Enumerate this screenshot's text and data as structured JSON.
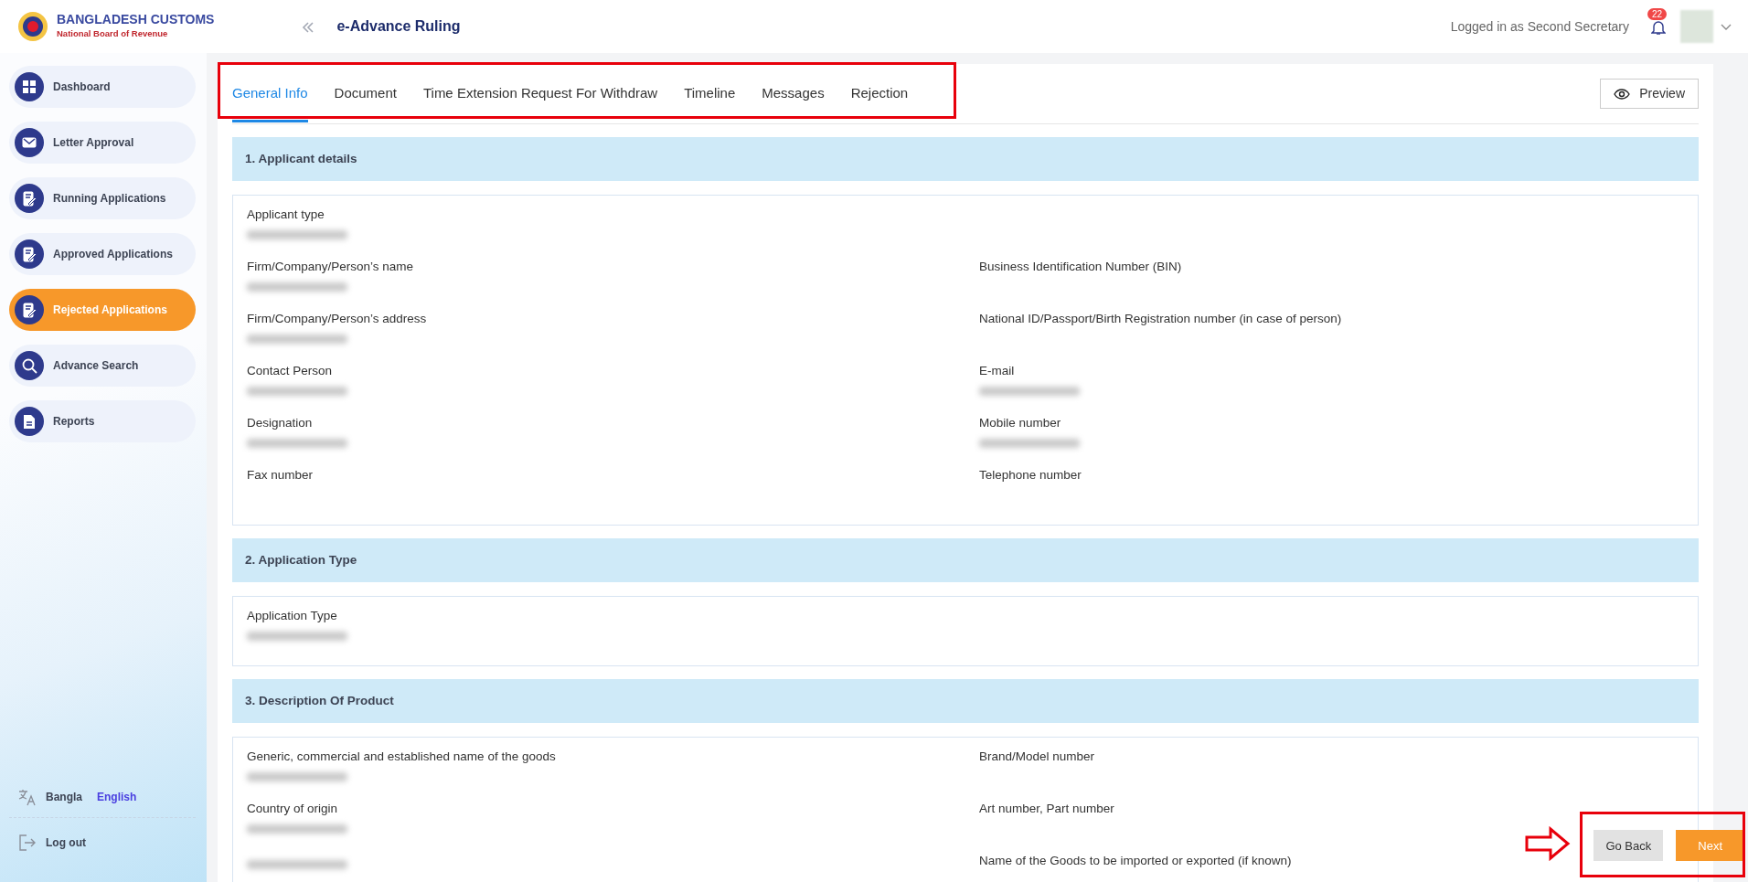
{
  "header": {
    "brand": "BANGLADESH CUSTOMS",
    "brand_subtitle": "National Board of Revenue",
    "title": "e-Advance Ruling",
    "user_text": "Logged in as Second Secretary",
    "notification_count": "22"
  },
  "sidebar": {
    "items": [
      {
        "label": "Dashboard",
        "selected": false
      },
      {
        "label": "Letter Approval",
        "selected": false
      },
      {
        "label": "Running Applications",
        "selected": false
      },
      {
        "label": "Approved Applications",
        "selected": false
      },
      {
        "label": "Rejected Applications",
        "selected": true
      },
      {
        "label": "Advance Search",
        "selected": false
      },
      {
        "label": "Reports",
        "selected": false
      }
    ],
    "languages": [
      {
        "label": "Bangla",
        "selected": false
      },
      {
        "label": "English",
        "selected": true
      }
    ],
    "logout": "Log out"
  },
  "tabs": [
    {
      "label": "General Info",
      "selected": true
    },
    {
      "label": "Document",
      "selected": false
    },
    {
      "label": "Time Extension Request For Withdraw",
      "selected": false
    },
    {
      "label": "Timeline",
      "selected": false
    },
    {
      "label": "Messages",
      "selected": false
    },
    {
      "label": "Rejection",
      "selected": false
    }
  ],
  "preview_button": "Preview",
  "sections": [
    {
      "title": "1. Applicant details",
      "right_offset": true,
      "left": [
        {
          "label": "Applicant type",
          "redacted": true
        },
        {
          "label": "Firm/Company/Person’s name",
          "redacted": true
        },
        {
          "label": "Firm/Company/Person’s address",
          "redacted": true
        },
        {
          "label": "Contact Person",
          "redacted": true
        },
        {
          "label": "Designation",
          "redacted": true
        },
        {
          "label": "Fax number",
          "redacted": false
        }
      ],
      "right": [
        {
          "label": "Business Identification Number (BIN)",
          "redacted": false
        },
        {
          "label": "National ID/Passport/Birth Registration number (in case of person)",
          "redacted": false
        },
        {
          "label": "E-mail",
          "redacted": true
        },
        {
          "label": "Mobile number",
          "redacted": true
        },
        {
          "label": "Telephone number",
          "redacted": false
        }
      ]
    },
    {
      "title": "2. Application Type",
      "right_offset": false,
      "left": [
        {
          "label": "Application Type",
          "redacted": true
        }
      ]
    },
    {
      "title": "3. Description Of Product",
      "right_offset": false,
      "left": [
        {
          "label": "Generic, commercial and established name of the goods",
          "redacted": true
        },
        {
          "label": "Country of origin",
          "redacted": true
        },
        {
          "redacted": true
        }
      ],
      "right": [
        {
          "label": "Brand/Model number",
          "redacted": false
        },
        {
          "label": "Art number, Part number",
          "redacted": false
        },
        {
          "label": "Name of the Goods to be imported or exported (if known)",
          "redacted": false
        }
      ]
    }
  ],
  "footer_buttons": [
    {
      "label": "Go Back",
      "kind": "secondary"
    },
    {
      "label": "Next",
      "kind": "primary"
    }
  ]
}
